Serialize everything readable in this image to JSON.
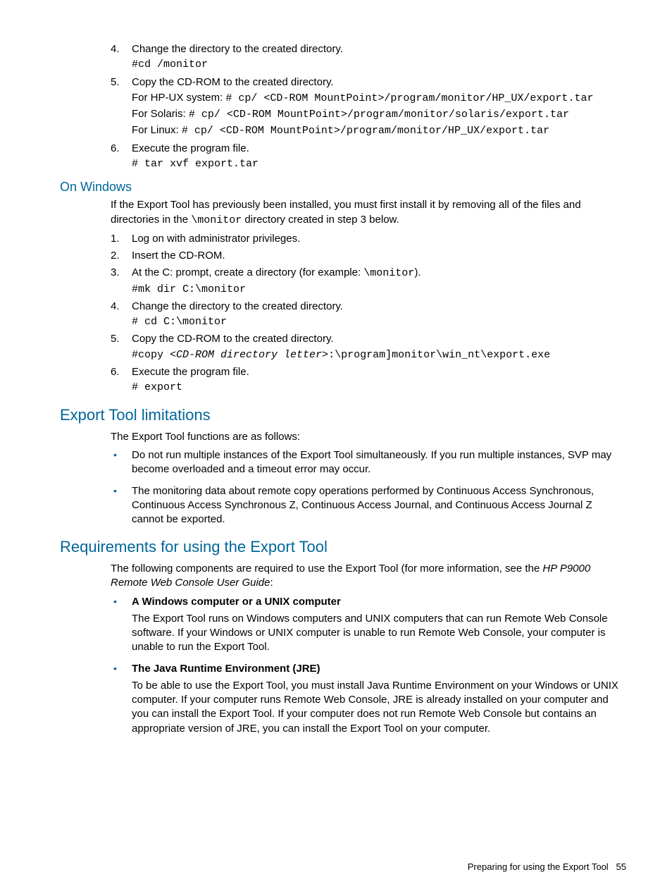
{
  "top_list": {
    "items": [
      {
        "num": "4.",
        "text": "Change the directory to the created directory.",
        "code": "#cd /monitor"
      },
      {
        "num": "5.",
        "text": "Copy the CD-ROM to the created directory.",
        "hpux_label": "For HP-UX system: ",
        "hpux_code": "# cp/ <CD-ROM MountPoint>/program/monitor/HP_UX/export.tar",
        "solaris_label": "For Solaris: ",
        "solaris_code": "# cp/ <CD-ROM MountPoint>/program/monitor/solaris/export.tar",
        "linux_label": "For Linux: ",
        "linux_code": "# cp/ <CD-ROM MountPoint>/program/monitor/HP_UX/export.tar"
      },
      {
        "num": "6.",
        "text": "Execute the program file.",
        "code": "# tar xvf export.tar"
      }
    ]
  },
  "windows": {
    "heading": "On Windows",
    "intro_a": "If the Export Tool has previously been installed, you must first install it by removing all of the files and directories in the ",
    "intro_code": "\\monitor",
    "intro_b": " directory created in step 3 below.",
    "items": [
      {
        "num": "1.",
        "text": "Log on with administrator privileges."
      },
      {
        "num": "2.",
        "text": "Insert the CD-ROM."
      },
      {
        "num": "3.",
        "text_a": "At the C: prompt, create a directory (for example: ",
        "text_code": "\\monitor",
        "text_b": ").",
        "code": "#mk dir C:\\monitor"
      },
      {
        "num": "4.",
        "text": "Change the directory to the created directory.",
        "code": "# cd C:\\monitor"
      },
      {
        "num": "5.",
        "text": "Copy the CD-ROM to the created directory.",
        "code_a": "#copy ",
        "code_italic": "<CD-ROM directory letter>",
        "code_b": ":\\program]monitor\\win_nt\\export.exe"
      },
      {
        "num": "6.",
        "text": "Execute the program file.",
        "code": "# export"
      }
    ]
  },
  "limitations": {
    "heading": "Export Tool limitations",
    "intro": "The Export Tool functions are as follows:",
    "bullets": [
      "Do not run multiple instances of the Export Tool simultaneously. If you run multiple instances, SVP may become overloaded and a timeout error may occur.",
      "The monitoring data about remote copy operations performed by Continuous Access Synchronous, Continuous Access Synchronous Z, Continuous Access Journal, and Continuous Access Journal Z cannot be exported."
    ]
  },
  "requirements": {
    "heading": "Requirements for using the Export Tool",
    "intro_a": "The following components are required to use the Export Tool (for more information, see the ",
    "intro_italic": "HP P9000 Remote Web Console User Guide",
    "intro_b": ":",
    "bullets": [
      {
        "title": "A Windows computer or a UNIX computer",
        "text": "The Export Tool runs on Windows computers and UNIX computers that can run Remote Web Console software. If your Windows or UNIX computer is unable to run Remote Web Console, your computer is unable to run the Export Tool."
      },
      {
        "title": "The Java Runtime Environment (JRE)",
        "text": "To be able to use the Export Tool, you must install Java Runtime Environment on your Windows or UNIX computer. If your computer runs Remote Web Console, JRE is already installed on your computer and you can install the Export Tool. If your computer does not run Remote Web Console but contains an appropriate version of JRE, you can install the Export Tool on your computer."
      }
    ]
  },
  "footer": {
    "text": "Preparing for using the Export Tool",
    "page": "55"
  }
}
